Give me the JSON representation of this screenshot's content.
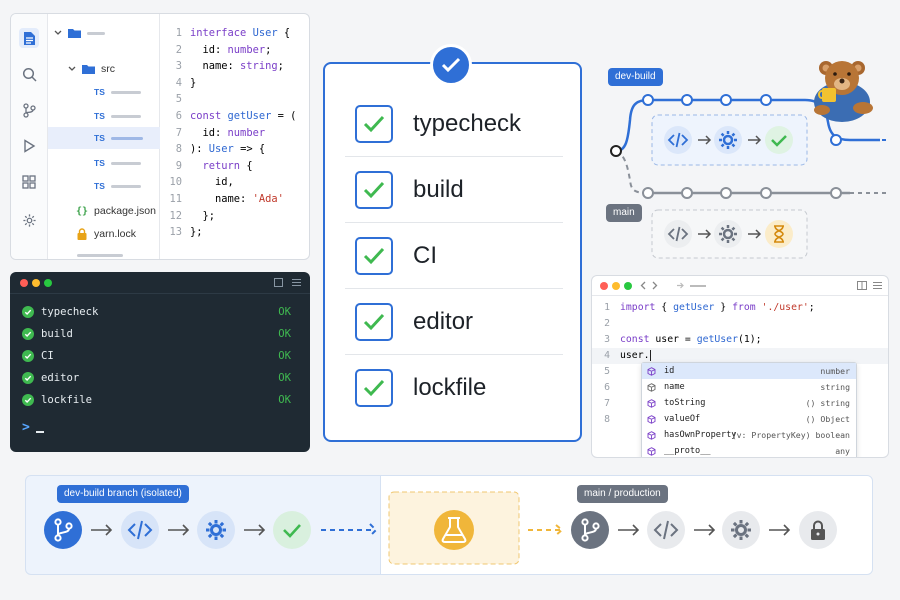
{
  "editor": {
    "tree": {
      "src_label": "src",
      "files": [
        {
          "badge": "TS"
        },
        {
          "badge": "TS"
        },
        {
          "badge": "TS"
        },
        {
          "badge": "TS"
        },
        {
          "badge": "TS"
        }
      ],
      "package_json": "package.json",
      "yarn_lock": "yarn.lock"
    },
    "code": {
      "line_numbers": [
        "1",
        "2",
        "3",
        "4",
        "5",
        "6",
        "7",
        "8",
        "9",
        "10",
        "11",
        "12",
        "13"
      ],
      "l1a": "interface ",
      "l1b": "User",
      "l1c": " {",
      "l2a": "  id: ",
      "l2b": "number",
      "l2c": ";",
      "l3a": "  name: ",
      "l3b": "string",
      "l3c": ";",
      "l4": "}",
      "l6a": "const ",
      "l6b": "getUser",
      "l6c": " = (",
      "l7a": "  id: ",
      "l7b": "number",
      "l8a": "): ",
      "l8b": "User",
      "l8c": " => {",
      "l9a": "  ",
      "l9b": "return",
      "l9c": " {",
      "l10": "    id,",
      "l11a": "    name: ",
      "l11b": "'Ada'",
      "l12": "  };",
      "l13": "};"
    }
  },
  "terminal": {
    "rows": [
      {
        "label": "typecheck",
        "status": "OK"
      },
      {
        "label": "build",
        "status": "OK"
      },
      {
        "label": "CI",
        "status": "OK"
      },
      {
        "label": "editor",
        "status": "OK"
      },
      {
        "label": "lockfile",
        "status": "OK"
      }
    ],
    "prompt": ">"
  },
  "checklist": {
    "items": [
      {
        "label": "typecheck"
      },
      {
        "label": "build"
      },
      {
        "label": "CI"
      },
      {
        "label": "editor"
      },
      {
        "label": "lockfile"
      }
    ]
  },
  "branches": {
    "dev_label": "dev-build",
    "main_label": "main"
  },
  "autocomplete": {
    "line_numbers": [
      "1",
      "2",
      "3",
      "4",
      "5",
      "6",
      "7",
      "8"
    ],
    "l1a": "import",
    "l1b": " { ",
    "l1c": "getUser",
    "l1d": " } ",
    "l1e": "from",
    "l1f": " './user'",
    "l1g": ";",
    "l3a": "const",
    "l3b": " user = ",
    "l3c": "getUser",
    "l3d": "(1);",
    "l4": "user.",
    "suggestions": [
      {
        "name": "id",
        "type": "number"
      },
      {
        "name": "name",
        "type": "string"
      },
      {
        "name": "toString",
        "type": "()  string"
      },
      {
        "name": "valueOf",
        "type": "()  Object"
      },
      {
        "name": "hasOwnProperty",
        "type": "(v: PropertyKey) boolean"
      },
      {
        "name": "__proto__",
        "type": "any"
      }
    ]
  },
  "pipeline": {
    "dev_label": "dev-build branch (isolated)",
    "main_label": "main / production"
  },
  "colors": {
    "accent": "#2f6fd6",
    "success": "#3fb950",
    "warning": "#f0b63a",
    "terminal_bg": "#1f2a33"
  }
}
